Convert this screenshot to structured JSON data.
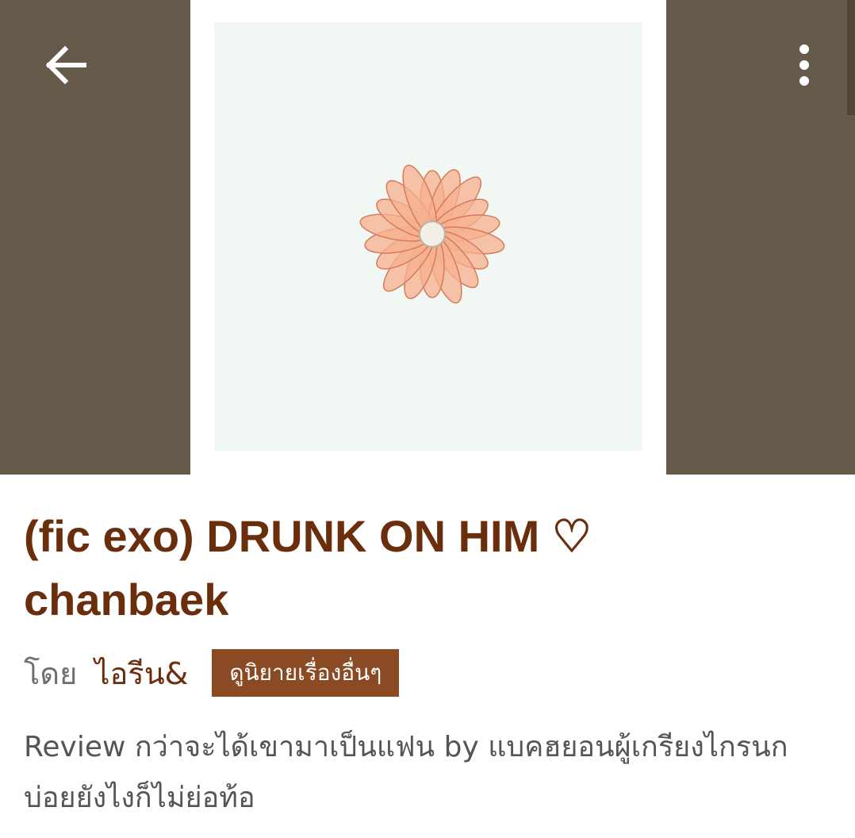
{
  "header": {
    "background_color": "#655949",
    "back_icon": "arrow-left-icon",
    "menu_icon": "more-vertical-icon"
  },
  "cover": {
    "image": "peach-daisy-flower",
    "background_color": "#f1f8f4",
    "petal_color": "#f5b08f"
  },
  "story": {
    "title": "(fic exo) DRUNK ON HIM ♡ chanbaek",
    "by_label": "โดย",
    "author": "ไอรีน&",
    "more_stories_label": "ดูนิยายเรื่องอื่นๆ",
    "synopsis": "Review กว่าจะได้เขามาเป็นแฟน by แบคฮยอนผู้เกรียงไกรนกบ่อยยังไงก็ไม่ย่อท้อ"
  },
  "colors": {
    "title": "#6b2e0c",
    "button_bg": "#8a4a24",
    "body_text": "#555555"
  }
}
